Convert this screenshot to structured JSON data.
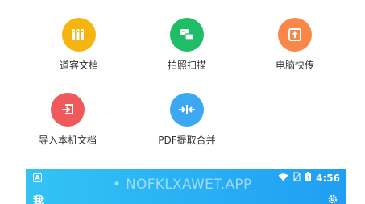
{
  "grid": {
    "items": [
      {
        "label": "道客文档",
        "icon": "books-icon",
        "color": "#f5b40f"
      },
      {
        "label": "拍照扫描",
        "icon": "scan-icon",
        "color": "#1fbe66"
      },
      {
        "label": "电脑快传",
        "icon": "upload-icon",
        "color": "#f88748"
      },
      {
        "label": "导入本机文档",
        "icon": "import-icon",
        "color": "#f0595c"
      },
      {
        "label": "PDF提取合并",
        "icon": "merge-icon",
        "color": "#3da8f2"
      }
    ]
  },
  "status_bar": {
    "notification_icon": "A",
    "watermark": "• NOFKLXAWET.APP",
    "time": "4:56",
    "bg_colors": [
      "#33c4f4",
      "#1f9ef3"
    ]
  },
  "header": {
    "title": "我",
    "settings_icon": "gear-icon"
  }
}
